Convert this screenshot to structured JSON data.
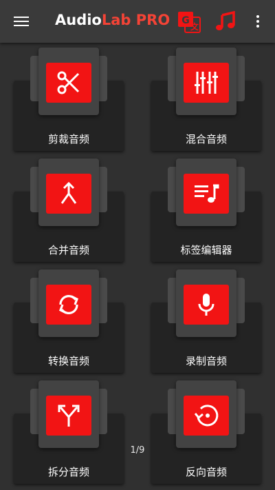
{
  "app": {
    "title_part1": "Audio",
    "title_part2": "Lab PRO"
  },
  "toolbar": {
    "menu_icon": "hamburger-menu-icon",
    "translate_icon": "translate-icon",
    "music_icon": "music-note-icon",
    "more_icon": "more-vertical-icon"
  },
  "colors": {
    "accent": "#f21414",
    "title_accent": "#f44336",
    "background": "#303030",
    "appbar": "#3a3a3a"
  },
  "tiles": [
    {
      "label": "剪裁音频",
      "icon": "scissors-icon"
    },
    {
      "label": "混合音频",
      "icon": "equalizer-sliders-icon"
    },
    {
      "label": "合并音频",
      "icon": "merge-arrow-icon"
    },
    {
      "label": "标签编辑器",
      "icon": "playlist-music-icon"
    },
    {
      "label": "转换音频",
      "icon": "sync-icon"
    },
    {
      "label": "录制音频",
      "icon": "microphone-icon"
    },
    {
      "label": "拆分音频",
      "icon": "split-arrow-icon"
    },
    {
      "label": "反向音频",
      "icon": "restore-icon"
    }
  ],
  "pagination": {
    "indicator": "1/9"
  }
}
